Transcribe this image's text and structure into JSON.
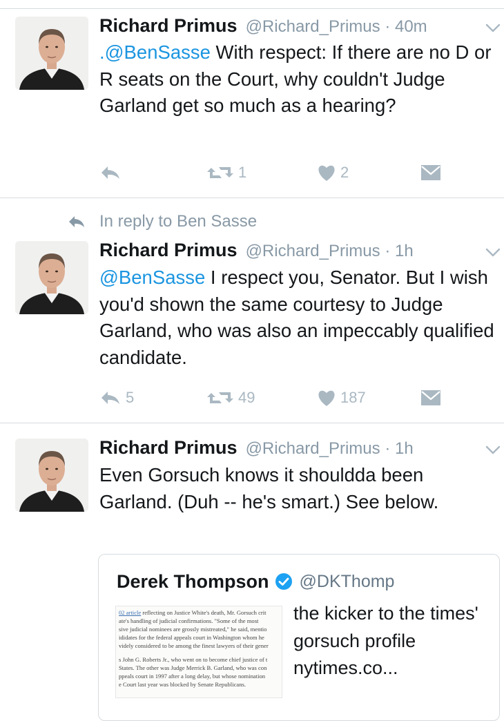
{
  "tweets": [
    {
      "name": "Richard Primus",
      "handle": "@Richard_Primus",
      "time": "40m",
      "mention": ".@BenSasse",
      "body": " With respect: If there are no D or R seats on the Court, why couldn't Judge Garland get so much as a hearing?",
      "reply_count": "",
      "retweet_count": "1",
      "like_count": "2"
    },
    {
      "reply_context": "In reply to Ben Sasse",
      "name": "Richard Primus",
      "handle": "@Richard_Primus",
      "time": "1h",
      "mention": "@BenSasse",
      "body": " I respect you, Senator. But I wish you'd shown the same courtesy to Judge Garland, who was also an impeccably qualified candidate.",
      "reply_count": "5",
      "retweet_count": "49",
      "like_count": "187"
    },
    {
      "name": "Richard Primus",
      "handle": "@Richard_Primus",
      "time": "1h",
      "body": "Even Gorsuch knows it shouldda been Garland.  (Duh -- he's smart.)  See below."
    }
  ],
  "quote": {
    "name": "Derek Thompson",
    "handle": "@DKThomp",
    "text": "the kicker to the times' gorsuch profile nytimes.co...",
    "thumb_lines": [
      {
        "link": "02 article",
        "text": " reflecting on Justice White's death, Mr. Gorsuch crit"
      },
      {
        "text": "ate's handling of judicial confirmations. \"Some of the most"
      },
      {
        "text": "sive judicial nominees are grossly mistreated,\" he said, mentio"
      },
      {
        "text": "ididates for the federal appeals court in Washington whom he"
      },
      {
        "text": "videly considered to be among the finest lawyers of their gener"
      },
      {
        "text": ""
      },
      {
        "text": "s John G. Roberts Jr., who went on to become chief justice of t"
      },
      {
        "text": "States. The other was Judge Merrick B. Garland, who was con"
      },
      {
        "text": "ppeals court in 1997 after a long delay, but whose nomination"
      },
      {
        "text": "e Court last year was blocked by Senate Republicans."
      }
    ]
  },
  "colors": {
    "link": "#1b95e0",
    "muted": "#8899a6",
    "action": "#aab8c2",
    "verified": "#1da1f2"
  },
  "icons": [
    "chevron-down-icon",
    "reply-icon",
    "retweet-icon",
    "heart-icon",
    "direct-message-icon",
    "verified-badge-icon"
  ]
}
